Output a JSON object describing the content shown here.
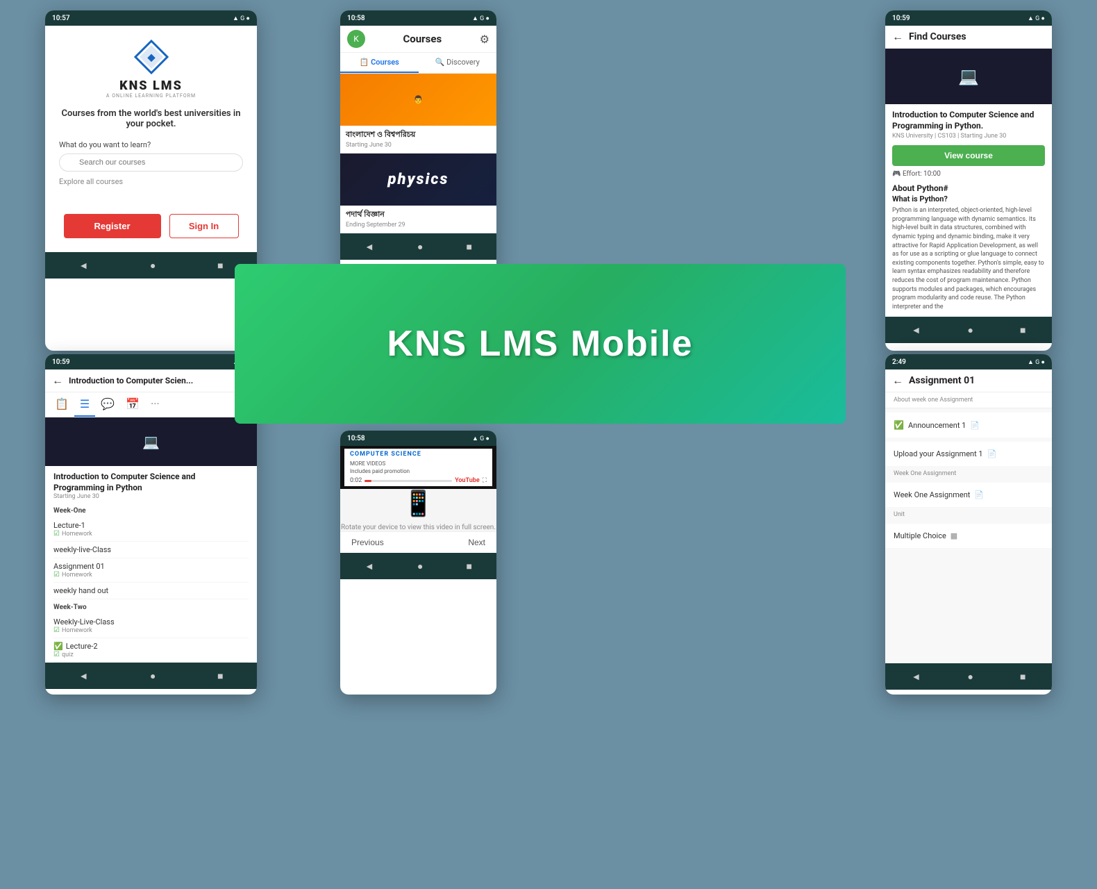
{
  "banner": {
    "text": "KNS LMS Mobile"
  },
  "phone1": {
    "status": {
      "time": "10:57",
      "icons": "▲◆ G ●"
    },
    "logo": {
      "title": "KNS LMS",
      "subtitle": "A ONLINE LEARNING PLATFORM"
    },
    "tagline": "Courses from the world's best universities in your pocket.",
    "learn_label": "What do you want to learn?",
    "search_placeholder": "Search our courses",
    "explore_link": "Explore all courses",
    "register_btn": "Register",
    "signin_btn": "Sign In"
  },
  "phone2": {
    "status": {
      "time": "10:58"
    },
    "header_title": "Courses",
    "tabs": [
      "Courses",
      "Discovery"
    ],
    "courses": [
      {
        "name": "বাংলাদেশ ও বিশ্বপরিচয়",
        "date": "Starting June 30"
      },
      {
        "name": "পদার্থ বিজ্ঞান",
        "date": "Ending September 29"
      }
    ]
  },
  "phone3": {
    "status": {
      "time": "10:59"
    },
    "header_title": "Find Courses",
    "course": {
      "title": "Introduction to Computer Science and Programming in Python.",
      "meta": "KNS University | CS103 | Starting June 30",
      "view_btn": "View course",
      "effort": "Effort:  10:00",
      "about_heading": "About Python#",
      "what_heading": "What is Python?",
      "description": "Python is an interpreted, object-oriented, high-level programming language with dynamic semantics. Its high-level built in data structures, combined with dynamic typing and dynamic binding, make it very attractive for Rapid Application Development, as well as for use as a scripting or glue language to connect existing components together. Python's simple, easy to learn syntax emphasizes readability and therefore reduces the cost of program maintenance. Python supports modules and packages, which encourages program modularity and code reuse. The Python interpreter and the"
    }
  },
  "phone4": {
    "status": {
      "time": "10:59"
    },
    "header_title": "Introduction to Computer Scien...",
    "course": {
      "title": "Introduction to Computer Science and Programming in Python",
      "date": "Starting June 30"
    },
    "weeks": [
      {
        "label": "Week-One",
        "items": [
          {
            "name": "Lecture-1",
            "sub": "Homework",
            "checked": false
          },
          {
            "name": "weekly-live-Class",
            "sub": "",
            "checked": false
          },
          {
            "name": "Assignment 01",
            "sub": "Homework",
            "checked": false
          },
          {
            "name": "weekly hand out",
            "sub": "",
            "checked": false
          }
        ]
      },
      {
        "label": "Week-Two",
        "items": [
          {
            "name": "Weekly-Live-Class",
            "sub": "Homework",
            "checked": false
          },
          {
            "name": "Lecture-2",
            "sub": "quiz",
            "checked": true
          }
        ]
      }
    ]
  },
  "phone5": {
    "status": {
      "time": "10:58"
    },
    "video_title": "COMPUTER SCIENCE",
    "more_videos": "MORE VIDEOS",
    "promo": "Includes paid promotion",
    "time_current": "0:02",
    "time_youtube": "YouTube",
    "rotate_text": "Rotate your device to view this video in full screen.",
    "nav_prev": "Previous",
    "nav_next": "Next"
  },
  "phone6": {
    "status": {
      "time": "2:49"
    },
    "header_title": "Assignment 01",
    "meta": "About week one Assignment",
    "sections": [
      {
        "label": "",
        "items": [
          {
            "name": "Announcement 1",
            "icon": "doc",
            "checked": true
          }
        ]
      },
      {
        "label": "",
        "items": [
          {
            "name": "Upload your Assignment 1",
            "icon": "doc",
            "checked": false
          }
        ]
      },
      {
        "label": "Week One Assignment",
        "items": [
          {
            "name": "Week One Assignment",
            "icon": "doc",
            "checked": false
          }
        ]
      },
      {
        "label": "Unit",
        "items": [
          {
            "name": "Multiple Choice",
            "icon": "grid",
            "checked": false
          }
        ]
      }
    ]
  }
}
